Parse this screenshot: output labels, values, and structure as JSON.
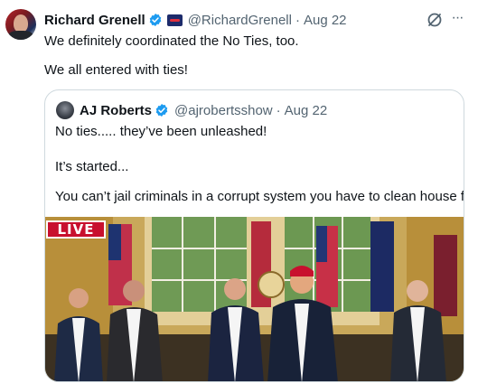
{
  "tweet": {
    "author_name": "Richard Grenell",
    "handle": "@RichardGrenell",
    "separator": "·",
    "date": "Aug 22",
    "more_glyph": "···",
    "line1": "We definitely coordinated the No Ties, too.",
    "line2": "We all entered with ties!"
  },
  "quote": {
    "author_name": "AJ Roberts",
    "handle": "@ajrobertsshow",
    "separator": "·",
    "date": "Aug 22",
    "line1": "No ties..... they’ve been unleashed!",
    "line2": "It’s started...",
    "line3": "You can’t jail criminals in a corrupt system you have to clean house first",
    "media": {
      "live_label": "LIVE"
    }
  },
  "colors": {
    "verified": "#1d9bf0",
    "secondary_text": "#536471",
    "border": "#cfd9de",
    "live_red": "#c8102e"
  },
  "icons": [
    "verified-badge-icon",
    "flag-badge-icon",
    "grok-icon",
    "more-icon"
  ]
}
